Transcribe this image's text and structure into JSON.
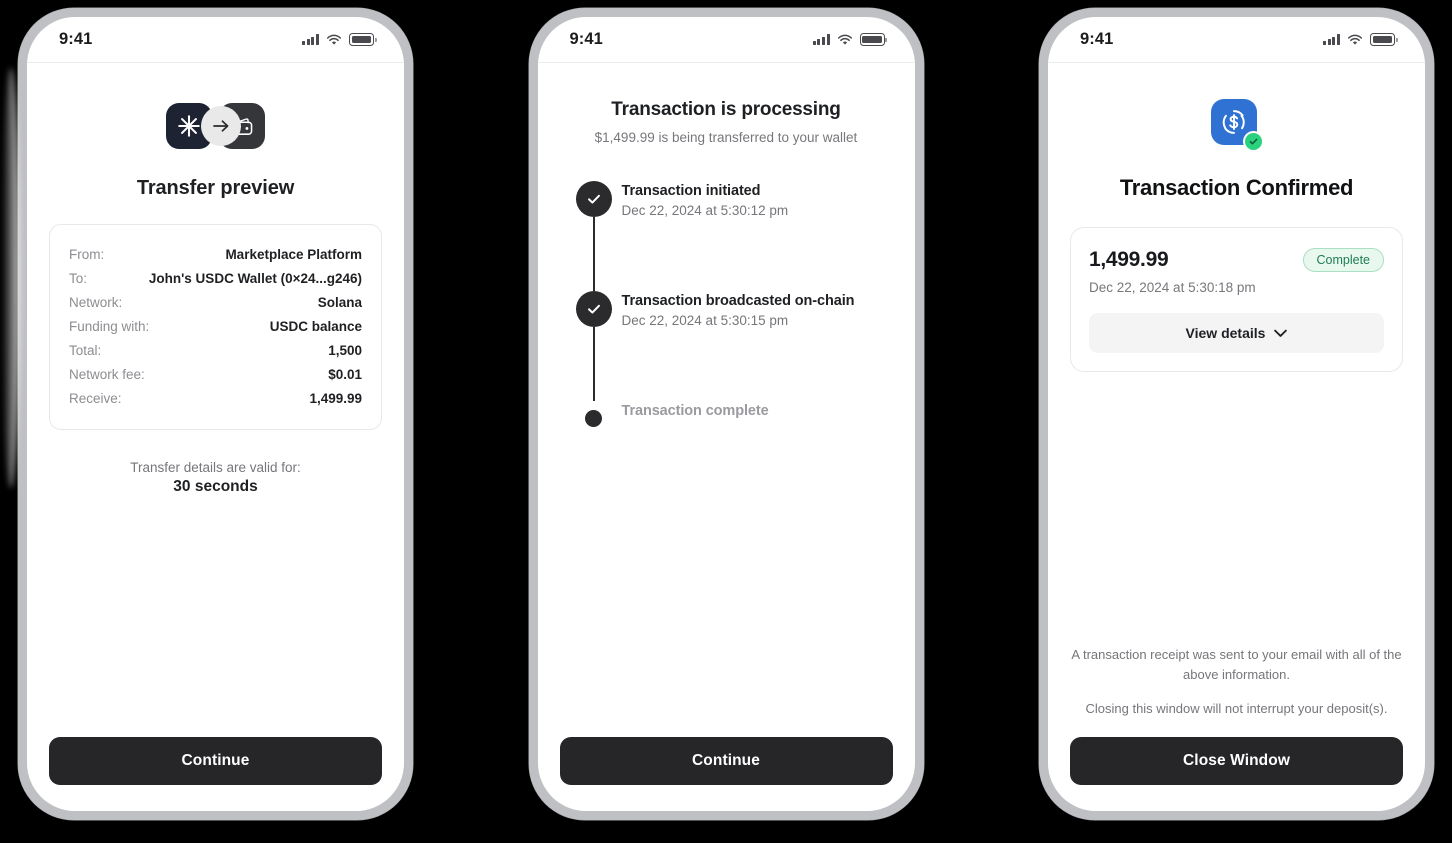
{
  "status_bar": {
    "time": "9:41",
    "icons": [
      "signal-icon",
      "wifi-icon",
      "battery-icon"
    ]
  },
  "colors": {
    "frame": "#bfc0c4",
    "button_dark": "#262628",
    "brand_navy": "#1d2333",
    "wallet_gray": "#35363a",
    "usdc_blue": "#2f72d4",
    "success_green": "#2ad17e",
    "badge_bg": "#e9f8ef",
    "badge_text": "#1e7d52"
  },
  "screen1": {
    "icons": {
      "brand": "asterisk-icon",
      "arrow": "arrow-right-icon",
      "wallet": "wallet-icon"
    },
    "title": "Transfer preview",
    "details": [
      {
        "label": "From:",
        "value": "Marketplace Platform"
      },
      {
        "label": "To:",
        "value": "John's USDC Wallet (0×24...g246)"
      },
      {
        "label": "Network:",
        "value": "Solana"
      },
      {
        "label": "Funding with:",
        "value": "USDC balance"
      },
      {
        "label": "Total:",
        "value": "1,500"
      },
      {
        "label": "Network fee:",
        "value": "$0.01"
      },
      {
        "label": "Receive:",
        "value": "1,499.99"
      }
    ],
    "validity_label": "Transfer details are valid for:",
    "validity_value": "30 seconds",
    "cta": "Continue"
  },
  "screen2": {
    "title": "Transaction is processing",
    "subtitle": "$1,499.99 is being transferred to your wallet",
    "steps": [
      {
        "title": "Transaction initiated",
        "time": "Dec 22, 2024 at 5:30:12 pm",
        "state": "done"
      },
      {
        "title": "Transaction broadcasted on-chain",
        "time": "Dec 22, 2024 at 5:30:15 pm",
        "state": "done"
      },
      {
        "title": "Transaction complete",
        "time": "",
        "state": "pending"
      }
    ],
    "cta": "Continue"
  },
  "screen3": {
    "icon": "usdc-coin-icon",
    "badge_icon": "check-circle-icon",
    "title": "Transaction Confirmed",
    "amount": "1,499.99",
    "status_badge": "Complete",
    "date": "Dec 22, 2024 at 5:30:18 pm",
    "view_details": "View details",
    "chevron": "chevron-down-icon",
    "note1": "A transaction receipt was sent to your email with all of the above information.",
    "note2": "Closing this window will not interrupt your deposit(s).",
    "cta": "Close Window"
  }
}
